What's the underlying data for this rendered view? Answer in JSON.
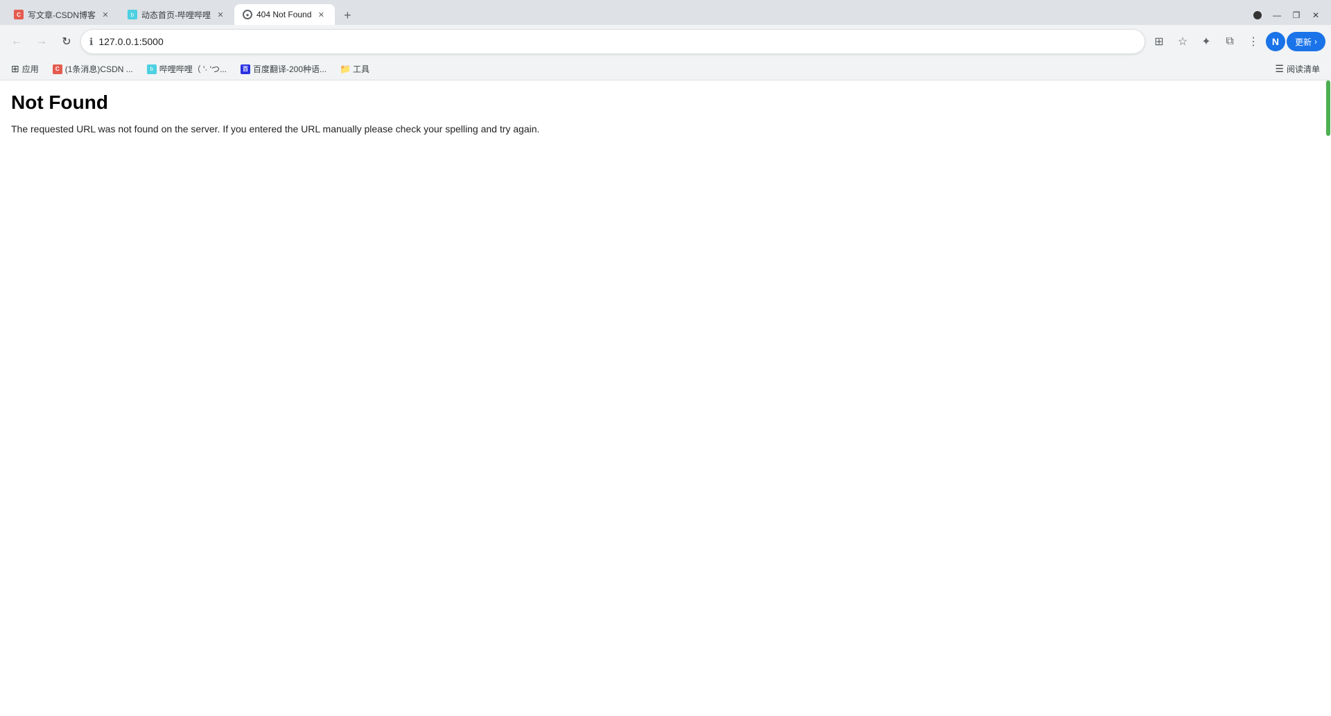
{
  "browser": {
    "tabs": [
      {
        "id": "tab1",
        "label": "写文章-CSDN博客",
        "favicon_type": "csdn",
        "favicon_letter": "C",
        "active": false
      },
      {
        "id": "tab2",
        "label": "动态首页-哔哩哔哩",
        "favicon_type": "note",
        "favicon_letter": "b",
        "active": false
      },
      {
        "id": "tab3",
        "label": "404 Not Found",
        "favicon_type": "globe",
        "favicon_letter": "●",
        "active": true
      }
    ],
    "new_tab_symbol": "+",
    "window_controls": {
      "minimize": "—",
      "maximize": "❐",
      "close": "✕"
    }
  },
  "toolbar": {
    "back_button": "←",
    "forward_button": "→",
    "refresh_button": "↻",
    "address": "127.0.0.1:5000",
    "security_icon": "ℹ",
    "bookmark_icon": "☆",
    "extensions_icon": "⧉",
    "profile_letter": "N",
    "update_label": "更新",
    "menu_icon": "⋮",
    "grid_icon": "⊞",
    "customize_icon": "✦"
  },
  "bookmarks": {
    "apps_label": "应用",
    "items": [
      {
        "label": "(1条消息)CSDN ...",
        "favicon_type": "csdn",
        "favicon_letter": "C"
      },
      {
        "label": "哔哩哔哩（ '· 'つ...",
        "favicon_type": "note",
        "favicon_letter": "b"
      },
      {
        "label": "百度翻译-200种语...",
        "favicon_type": "baidu",
        "favicon_letter": "百"
      },
      {
        "label": "工具",
        "favicon_type": "folder",
        "favicon_letter": "📁"
      }
    ],
    "reading_list_label": "阅读清单"
  },
  "page": {
    "heading": "Not Found",
    "description": "The requested URL was not found on the server. If you entered the URL manually please check your spelling and try again."
  }
}
